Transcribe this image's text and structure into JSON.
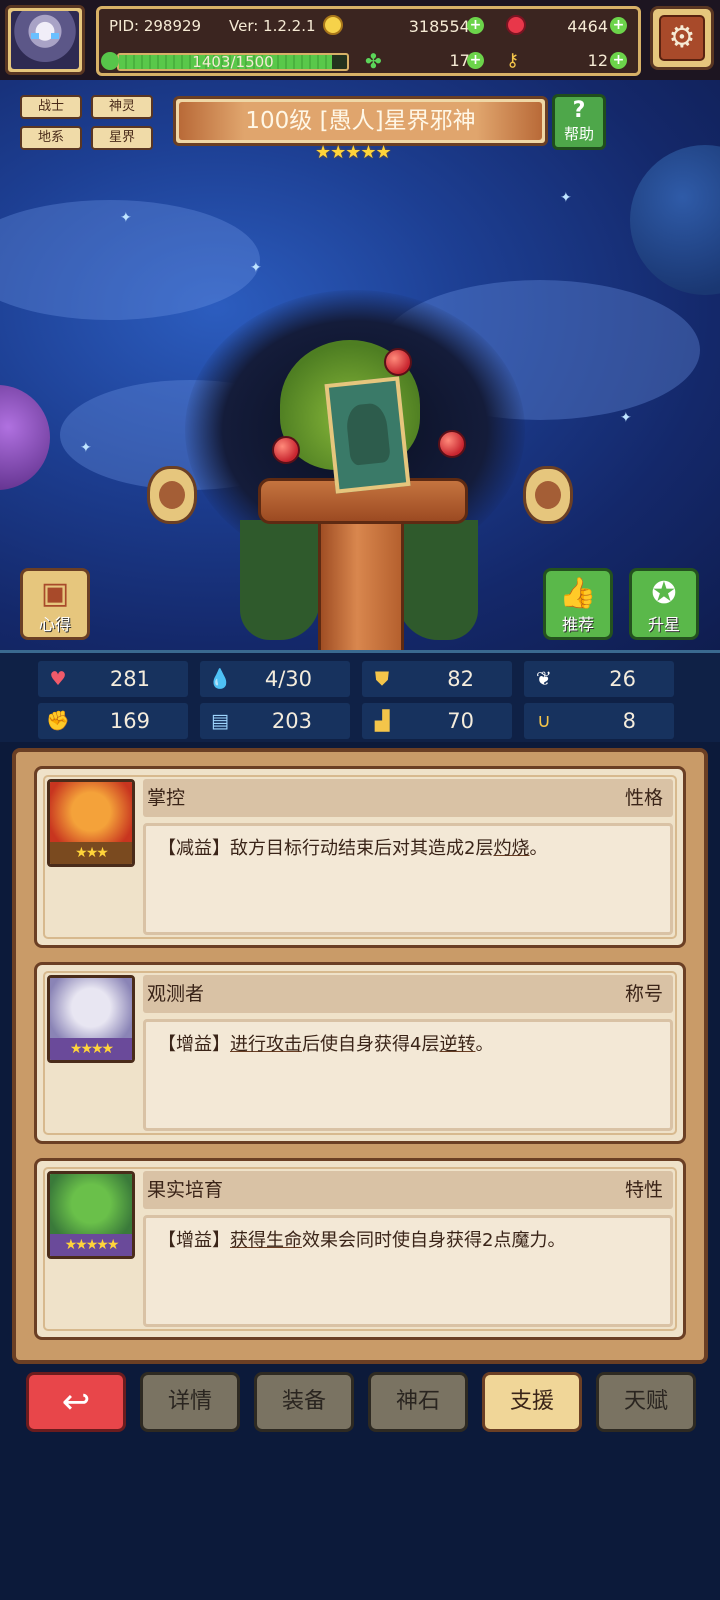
{
  "topbar": {
    "pid": "PID: 298929",
    "version": "Ver: 1.2.2.1",
    "gold": "3185545",
    "gems": "4464",
    "exp_text": "1403/1500",
    "exp_fraction": 0.935,
    "clover": "177",
    "keys": "12",
    "plus": "+",
    "settings_icon": "⚙"
  },
  "hero": {
    "tags": [
      "战士",
      "神灵",
      "地系",
      "星界"
    ],
    "title": "100级 [愚人]星界邪神",
    "stars": "★★★★★",
    "help_label": "帮助",
    "help_icon": "?",
    "left_button_label": "心得",
    "recommend_label": "推荐",
    "star_up_label": "升星"
  },
  "stats": [
    {
      "icon": "heart-icon",
      "glyph": "♥",
      "color": "#f05a6a",
      "value": "281"
    },
    {
      "icon": "drop-icon",
      "glyph": "💧",
      "color": "#7ad4ff",
      "value": "4/30"
    },
    {
      "icon": "shield-icon",
      "glyph": "⛊",
      "color": "#f4c54a",
      "value": "82"
    },
    {
      "icon": "wing-icon",
      "glyph": "❦",
      "color": "#ffffff",
      "value": "26"
    },
    {
      "icon": "fist-icon",
      "glyph": "✊",
      "color": "#f08a6a",
      "value": "169"
    },
    {
      "icon": "book-icon",
      "glyph": "▤",
      "color": "#9fd6ff",
      "value": "203"
    },
    {
      "icon": "boot-icon",
      "glyph": "▟",
      "color": "#f4c54a",
      "value": "70"
    },
    {
      "icon": "horseshoe-icon",
      "glyph": "∪",
      "color": "#f4c54a",
      "value": "8"
    }
  ],
  "support_cards": [
    {
      "name": "掌控",
      "type": "性格",
      "rank": "★★★",
      "face_colors": [
        "#f4a23a",
        "#c8351f"
      ],
      "desc_prefix": "【减益】敌方目标行动结束后对其造成2层",
      "desc_kw1": "灼烧",
      "desc_mid": "。",
      "desc_kw2": "",
      "desc_suffix": ""
    },
    {
      "name": "观测者",
      "type": "称号",
      "rank": "★★★★",
      "face_colors": [
        "#e8e6f2",
        "#8a84b6"
      ],
      "desc_prefix": "【增益】",
      "desc_kw1": "进行攻击",
      "desc_mid": "后使自身获得4层",
      "desc_kw2": "逆转",
      "desc_suffix": "。"
    },
    {
      "name": "果实培育",
      "type": "特性",
      "rank": "★★★★★",
      "face_colors": [
        "#6ac04a",
        "#3a7a3a"
      ],
      "desc_prefix": "【增益】",
      "desc_kw1": "获得生命",
      "desc_mid": "效果会同时使自身获得2点魔力。",
      "desc_kw2": "",
      "desc_suffix": ""
    }
  ],
  "nav": {
    "back_icon": "↩",
    "tabs": [
      "详情",
      "装备",
      "神石",
      "支援",
      "天赋"
    ],
    "active": "支援"
  }
}
